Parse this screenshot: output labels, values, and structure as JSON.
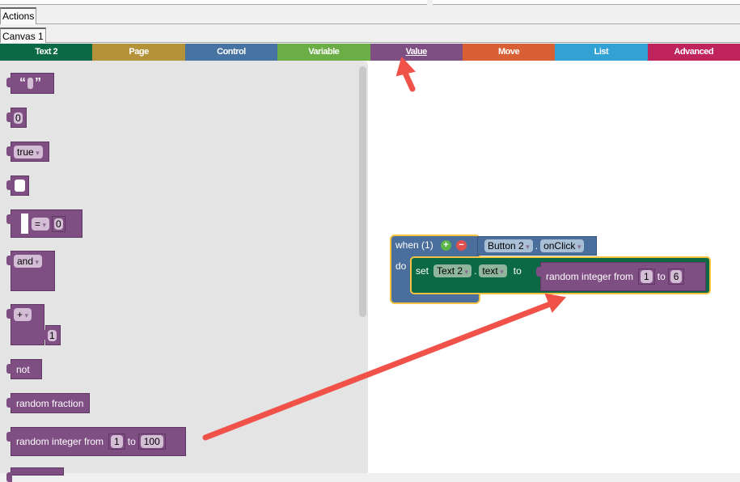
{
  "tabs": {
    "actions": "Actions",
    "canvas": "Canvas 1"
  },
  "categories": [
    {
      "label": "Text 2",
      "color": "#0b6a45"
    },
    {
      "label": "Page",
      "color": "#b3923a"
    },
    {
      "label": "Control",
      "color": "#4673a2"
    },
    {
      "label": "Variable",
      "color": "#6bae45"
    },
    {
      "label": "Value",
      "color": "#7f4f84",
      "active": true
    },
    {
      "label": "Move",
      "color": "#d95f35"
    },
    {
      "label": "List",
      "color": "#32a2d4"
    },
    {
      "label": "Advanced",
      "color": "#c0245d"
    }
  ],
  "flyout": {
    "text_quotes_open": "“",
    "text_quotes_close": "”",
    "number": "0",
    "boolean": "true",
    "compare_op": "=",
    "compare_val": "0",
    "logic": "and",
    "math_op": "+",
    "math_val": "1",
    "not": "not",
    "random_fraction": "random fraction",
    "random_int": {
      "label": "random integer from",
      "from": "1",
      "to_label": "to",
      "to": "100"
    }
  },
  "event": {
    "when": "when (1)",
    "component": "Button 2",
    "dot": ".",
    "event": "onClick",
    "do": "do",
    "set": "set",
    "target": "Text 2",
    "property": "text",
    "to": "to",
    "random_int": {
      "label": "random integer from",
      "from": "1",
      "to_label": "to",
      "to": "6"
    }
  },
  "colors": {
    "arrow": "#f0524a",
    "value": "#7f4f84"
  }
}
